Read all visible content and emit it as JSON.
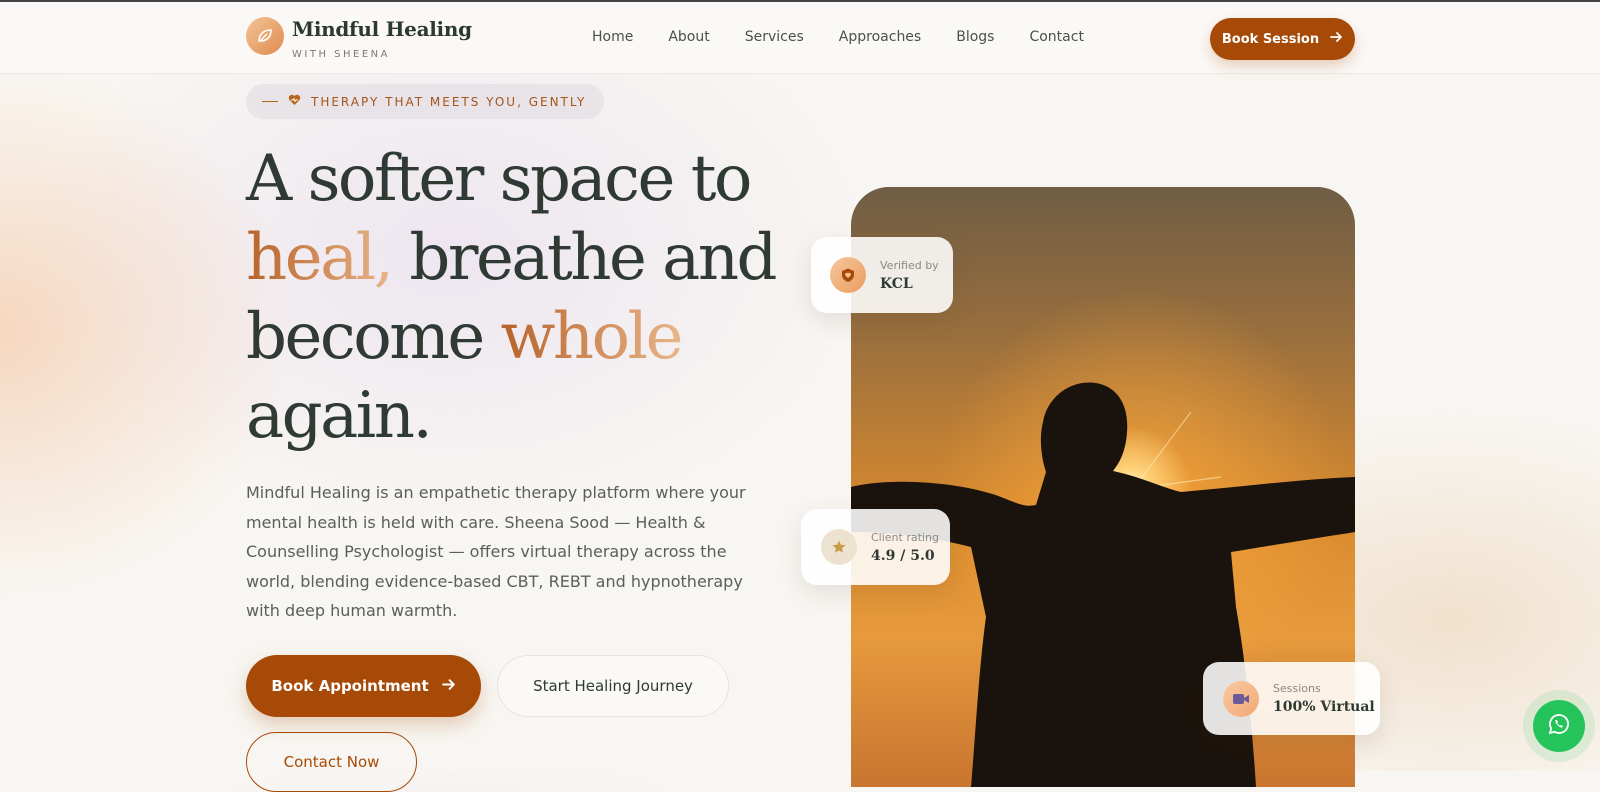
{
  "brand": {
    "name": "Mindful Healing",
    "subtitle": "WITH SHEENA"
  },
  "nav": {
    "items": [
      "Home",
      "About",
      "Services",
      "Approaches",
      "Blogs",
      "Contact"
    ]
  },
  "header": {
    "book_label": "Book Session"
  },
  "hero": {
    "tagline": "THERAPY THAT MEETS YOU, GENTLY",
    "headline": {
      "line1": "A softer space to",
      "accent1": "heal,",
      "line2_rest": " breathe and",
      "line3_start": "become ",
      "accent2": "whole",
      "line4": "again."
    },
    "description": "Mindful Healing is an empathetic therapy platform where your mental health is held with care. Sheena Sood — Health & Counselling Psychologist — offers virtual therapy across the world, blending evidence-based CBT, REBT and hypnotherapy with deep human warmth.",
    "cta_primary": "Book Appointment",
    "cta_secondary": "Start Healing Journey",
    "cta_outline": "Contact Now"
  },
  "cards": {
    "verified": {
      "label": "Verified by",
      "value": "KCL"
    },
    "rating": {
      "label": "Client rating",
      "value": "4.9 / 5.0"
    },
    "sessions": {
      "label": "Sessions",
      "value": "100% Virtual"
    }
  },
  "colors": {
    "accent": "#a84a07",
    "text": "#2e3a33",
    "whatsapp": "#25c45a"
  }
}
